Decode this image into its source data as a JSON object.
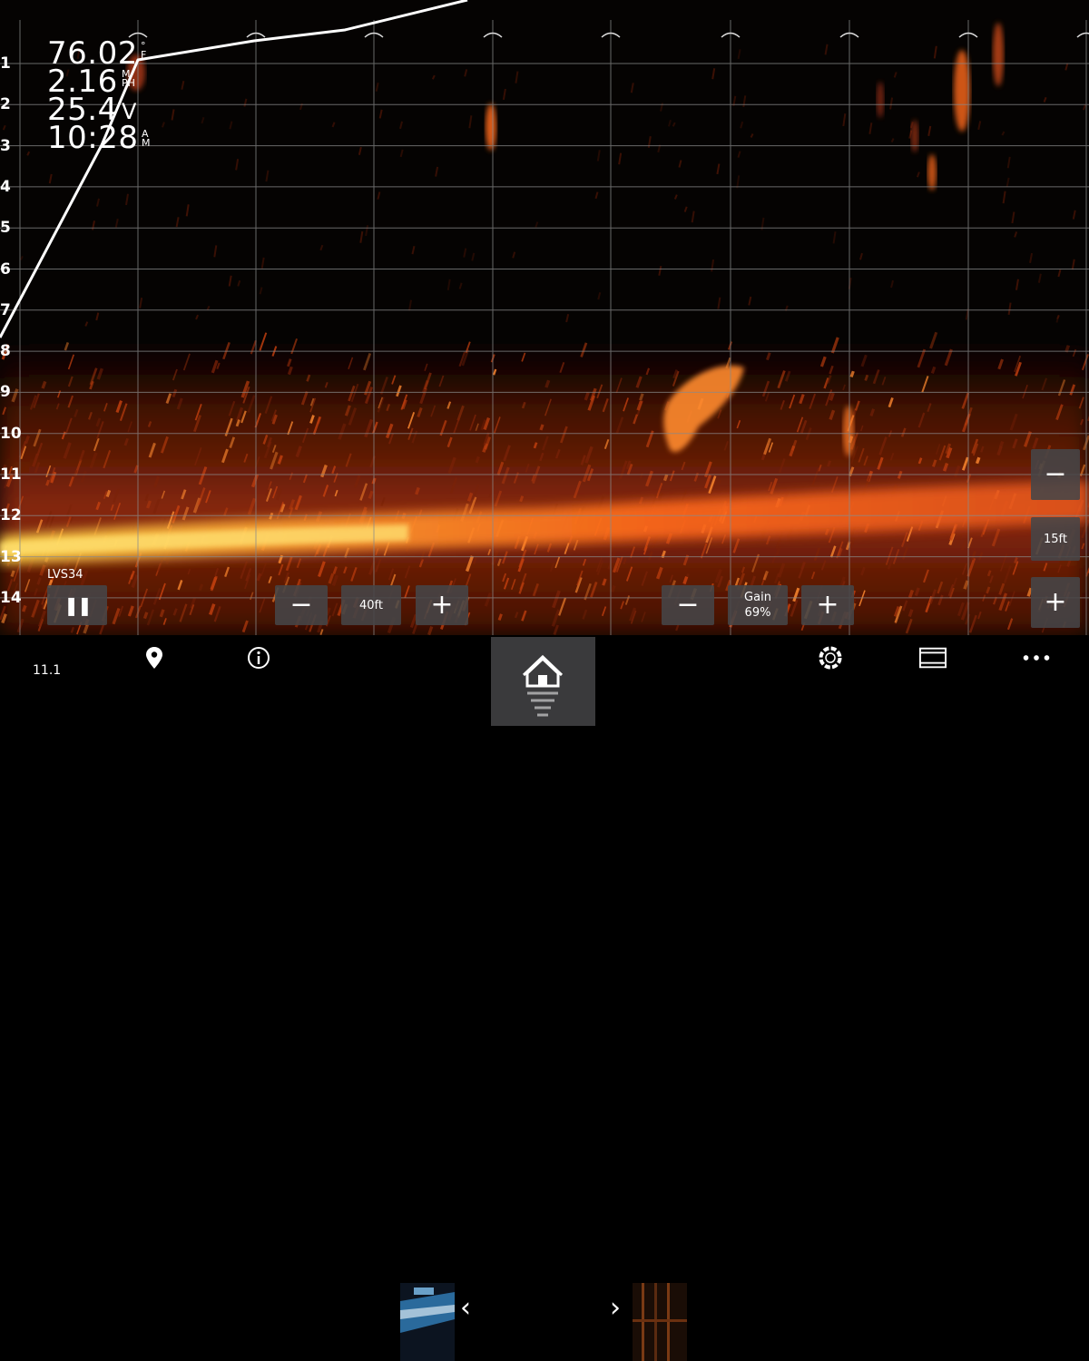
{
  "readouts": {
    "temperature": {
      "value": "76.02",
      "unit_top": "°",
      "unit_bottom": "F"
    },
    "speed": {
      "value": "2.16",
      "unit_top": "M",
      "unit_bottom": "PH"
    },
    "voltage": {
      "value": "25.4",
      "unit": "V"
    },
    "time": {
      "value": "10:28",
      "unit_top": "A",
      "unit_bottom": "M"
    }
  },
  "depth_scale": [
    "1",
    "2",
    "3",
    "4",
    "5",
    "6",
    "7",
    "8",
    "9",
    "10",
    "11",
    "12",
    "13",
    "14"
  ],
  "source_label": "LVS34",
  "controls": {
    "pause_glyph": "❚❚",
    "range_minus": "−",
    "range_value": "40ft",
    "range_plus": "+",
    "gain_minus": "−",
    "gain_label": "Gain",
    "gain_value": "69%",
    "gain_plus": "+",
    "zoom_minus": "−",
    "zoom_value": "15ft",
    "zoom_plus": "+"
  },
  "bottom_bar": {
    "value": "11.1",
    "items": [
      {
        "icon": "map-pin-icon",
        "label": ""
      },
      {
        "icon": "info-icon",
        "label": ""
      },
      {
        "icon": "lifebuoy-icon",
        "label": ""
      },
      {
        "icon": "window-icon",
        "label": ""
      },
      {
        "icon": "more-icon",
        "label": ""
      }
    ],
    "prev_glyph": "‹",
    "next_glyph": "›"
  },
  "colors": {
    "echo_bright": "#ffd84a",
    "echo_mid": "#ff6a1a",
    "echo_dark": "#8a2208",
    "grid": "#8a8a8a",
    "button_bg": "#464648"
  }
}
